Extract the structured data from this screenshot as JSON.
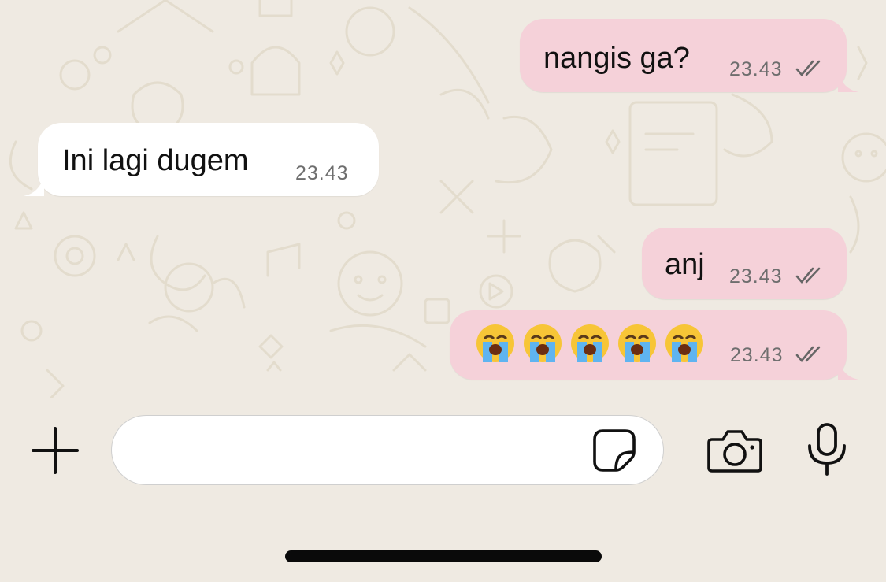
{
  "messages": [
    {
      "direction": "outgoing",
      "text": "nangis ga?",
      "time": "23.43",
      "status": "read-ticks"
    },
    {
      "direction": "incoming",
      "text": "Ini lagi dugem",
      "time": "23.43"
    },
    {
      "direction": "outgoing",
      "text": "anj",
      "time": "23.43",
      "status": "read-ticks"
    },
    {
      "direction": "outgoing",
      "emoji": [
        "😭",
        "😭",
        "😭",
        "😭",
        "😭"
      ],
      "time": "23.43",
      "status": "read-ticks"
    }
  ],
  "composer": {
    "placeholder": "",
    "left_icon": "plus-icon",
    "inline_icon": "sticker-icon",
    "right_icons": [
      "camera-icon",
      "microphone-icon"
    ]
  },
  "colors": {
    "background": "#efeae2",
    "outgoing_bubble": "#f5d1d9",
    "incoming_bubble": "#ffffff",
    "timestamp": "#6e6e6e",
    "text": "#111111"
  }
}
